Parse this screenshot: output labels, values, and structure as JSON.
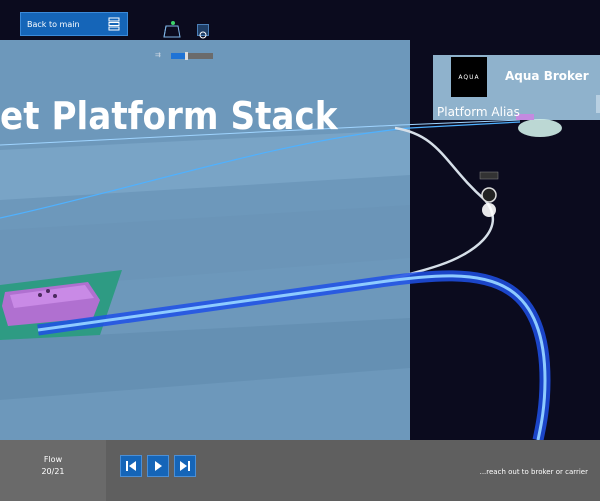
{
  "header": {
    "back_label": "Back to main"
  },
  "icons": {
    "back_button_icon": "server-icon",
    "toolbar_icon_1": "cube-icon",
    "toolbar_icon_2": "target-icon",
    "slider_icon": "speed-icon"
  },
  "toolbar": {
    "speed_level": 0.35
  },
  "scene": {
    "title": "et Platform Stack",
    "broker_name": "Aqua Broker",
    "broker_logo": "AQUA",
    "alias_label": "Platform Alias"
  },
  "footer": {
    "flow_label": "Flow",
    "flow_count": "20/21",
    "status_text": "...reach out to broker or carrier"
  },
  "colors": {
    "accent_blue": "#1565b8",
    "panel_bg": "#6f9bbd",
    "footer_bg": "#5f5f5f"
  }
}
